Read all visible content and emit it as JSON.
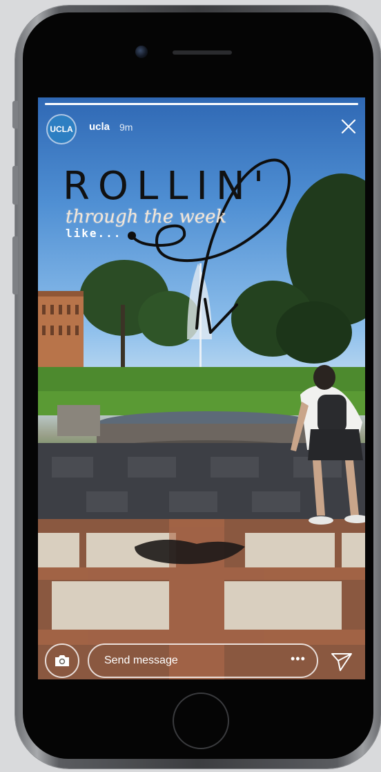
{
  "story": {
    "account_logo_text": "UCLA",
    "username": "ucla",
    "timestamp": "9m",
    "progress": 1.0
  },
  "overlay": {
    "headline": "ROLLIN'",
    "subtitle": "through the week",
    "like_text": "like..."
  },
  "footer": {
    "message_placeholder": "Send message",
    "more_label": "•••"
  },
  "icons": {
    "camera": "camera-icon",
    "close": "close-icon",
    "send": "send-icon"
  },
  "colors": {
    "brand": "#2d7fc2",
    "text": "#ffffff"
  }
}
